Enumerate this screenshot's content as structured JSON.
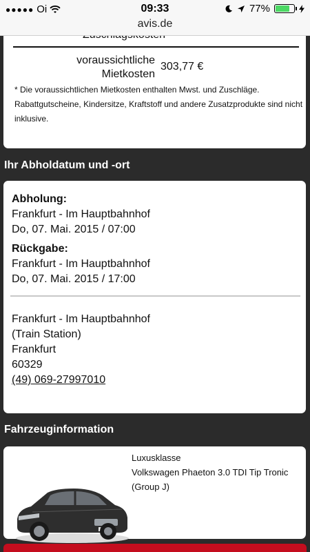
{
  "status_bar": {
    "carrier": "Oi",
    "time": "09:33",
    "battery_percent": "77%",
    "battery_level": 0.77
  },
  "browser": {
    "url": "avis.de"
  },
  "cost_summary": {
    "cut_off_label": "Zuschlagskosten",
    "estimated_label_line1": "voraussichtliche",
    "estimated_label_line2": "Mietkosten",
    "estimated_value": "303,77 €",
    "footnote": "* Die voraussichtlichen Mietkosten enthalten Mwst. und Zuschläge. Rabattgutscheine, Kindersitze, Kraftstoff und andere Zusatzprodukte sind nicht inklusive."
  },
  "pickup_section": {
    "title": "Ihr Abholdatum und -ort",
    "pickup_heading": "Abholung:",
    "pickup_location": "Frankfurt - Im Hauptbahnhof",
    "pickup_datetime": "Do, 07. Mai. 2015 / 07:00",
    "return_heading": "Rückgabe:",
    "return_location": "Frankfurt - Im Hauptbahnhof",
    "return_datetime": "Do, 07. Mai. 2015 / 17:00",
    "address_line1": "Frankfurt - Im Hauptbahnhof",
    "address_line2": "(Train Station)",
    "address_city": "Frankfurt",
    "address_zip": "60329",
    "phone": "(49) 069-27997010"
  },
  "vehicle_section": {
    "title": "Fahrzeuginformation",
    "class": "Luxusklasse",
    "model": "Volkswagen Phaeton 3.0 TDI Tip Tronic",
    "group": "(Group J)"
  }
}
